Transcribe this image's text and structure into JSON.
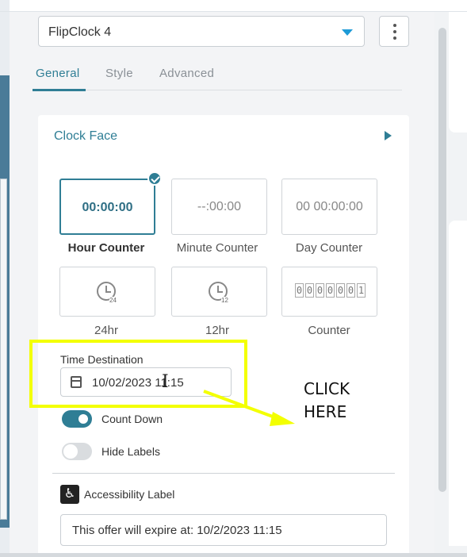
{
  "dropdown": {
    "value": "FlipClock 4"
  },
  "tabs": [
    {
      "label": "General",
      "active": true
    },
    {
      "label": "Style",
      "active": false
    },
    {
      "label": "Advanced",
      "active": false
    }
  ],
  "section": {
    "title": "Clock Face"
  },
  "faces": [
    {
      "preview": "00:00:00",
      "label": "Hour Counter",
      "selected": true
    },
    {
      "preview": "--:00:00",
      "label": "Minute Counter",
      "selected": false
    },
    {
      "preview": "00 00:00:00",
      "label": "Day Counter",
      "selected": false
    },
    {
      "preview_num": "24",
      "label": "24hr",
      "selected": false
    },
    {
      "preview_num": "12",
      "label": "12hr",
      "selected": false
    },
    {
      "preview_digits": [
        "0",
        "0",
        "0",
        "0",
        "0",
        "0",
        "1"
      ],
      "label": "Counter",
      "selected": false
    }
  ],
  "time_destination": {
    "label": "Time Destination",
    "value": "10/02/2023 11:15"
  },
  "toggles": {
    "count_down": {
      "label": "Count Down",
      "on": true
    },
    "hide_labels": {
      "label": "Hide Labels",
      "on": false
    }
  },
  "accessibility": {
    "label": "Accessibility Label",
    "value": "This offer will expire at: 10/2/2023 11:15",
    "icon": "wheelchair-icon"
  },
  "annotation": {
    "line1": "CLICK",
    "line2": "HERE",
    "color": "#f3ff00"
  },
  "colors": {
    "accent": "#2f7e95",
    "caret": "#1e9bd7"
  }
}
